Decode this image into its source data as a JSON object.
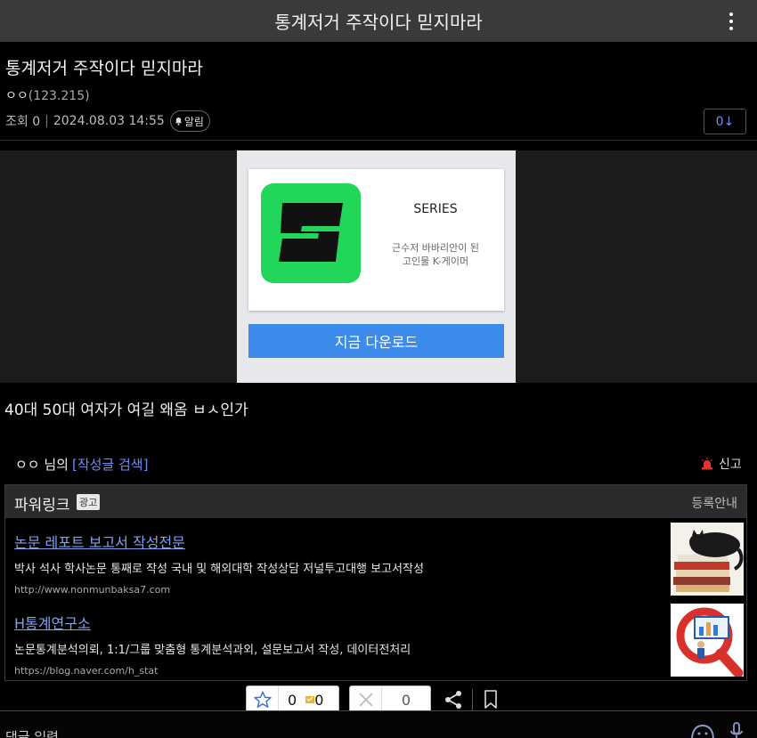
{
  "header": {
    "title": "통계저거 주작이다 믿지마라",
    "menu_icon": "kebab-menu-icon"
  },
  "post": {
    "title": "통계저거 주작이다 믿지마라",
    "author_name": "ㅇㅇ",
    "author_ip": "(123.215)",
    "views_label": "조회 0",
    "date": "2024.08.03 14:55",
    "alarm_label": "알림",
    "recommend_count_label": "0↓",
    "body": "40대 50대 여자가 여길 왜옴 ㅂㅅ인가"
  },
  "ad": {
    "app_name": "SERIES",
    "desc_line1": "근수저 바바리안이 된",
    "desc_line2": "고인물 K-게이머",
    "download_label": "지금 다운로드",
    "icon_color": "#22d65a",
    "button_color": "#3c8beb"
  },
  "writer": {
    "name_suffix": "ㅇㅇ 님의",
    "search_label": "[작성글 검색]",
    "report_label": "신고"
  },
  "powerlink": {
    "title": "파워링크",
    "badge": "광고",
    "register_label": "등록안내",
    "items": [
      {
        "title": "논문 레포트 보고서 작성전문",
        "desc": "박사 석사 학사논문 통째로 작성 국내 및 해외대학 작성상담 저널투고대행 보고서작성",
        "url": "http://www.nonmunbaksa7.com"
      },
      {
        "title": "H통계연구소",
        "desc": "논문통계분석의뢰, 1:1/그룹 맞춤형 통계분석과외, 설문보고서 작성, 데이터전처리",
        "url": "https://blog.naver.com/h_stat"
      }
    ]
  },
  "actions": {
    "recommend_count": "0",
    "fix_count": "0",
    "unrecommend_count": "0"
  },
  "comment": {
    "placeholder": "댓글 입력"
  },
  "colors": {
    "link": "#7fa2ee",
    "accent_blue": "#6f8df0",
    "topbar": "#3a3a3a",
    "report_red": "#e5322d"
  }
}
